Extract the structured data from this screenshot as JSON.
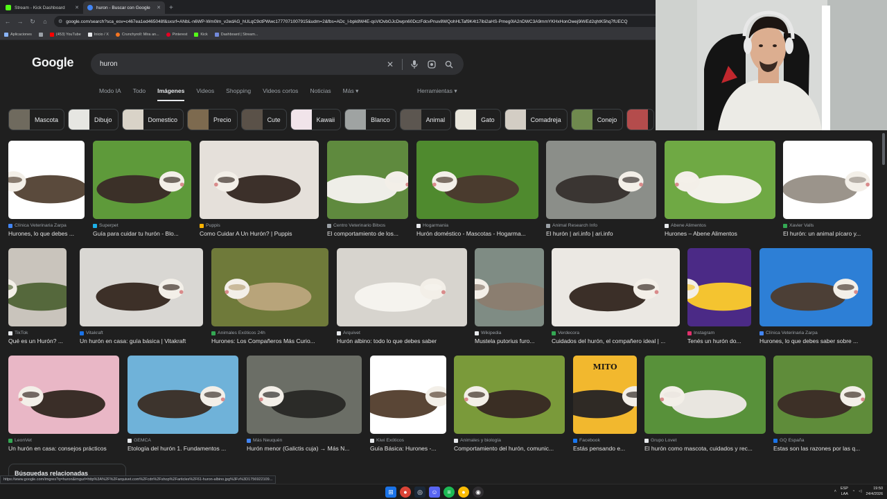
{
  "browser": {
    "tabs": [
      {
        "title": "Stream - Kick Dashboard",
        "favicon_color": "#53fc18"
      },
      {
        "title": "huron - Buscar con Google",
        "favicon_color": "#4285f4"
      }
    ],
    "new_tab_label": "+",
    "url": "google.com/search?sca_esv=c467ea1ed465048f&sxsrf=ANbL-n6WP-Wm0lm_v2edAG_hULqC9ctPWwc1777071007915&udm=2&fbs=ADc_l-bpk8W4E-qsVlOvbGJcDwpn60DczFdcvPnuv8WQohHLTaf9K4t17ibi2aHS-Pmeg0lA2nDWC3A9mmYKHxHonOwej9iWEd2qhtK5hq7fUECQ",
    "bookmarks": [
      {
        "label": "Aplicaciones",
        "color": "#8ab4f8"
      },
      {
        "label": "",
        "color": "#9aa0a6"
      },
      {
        "label": "(453) YouTube",
        "color": "#ff0000"
      },
      {
        "label": "Inicio / X",
        "color": "#e8eaed"
      },
      {
        "label": "Crunchyroll: Mira an...",
        "color": "#f47521"
      },
      {
        "label": "Pinterest",
        "color": "#e60023"
      },
      {
        "label": "Kick",
        "color": "#53fc18"
      },
      {
        "label": "Dashboard | Stream...",
        "color": "#7289da"
      }
    ]
  },
  "google": {
    "logo": "Google",
    "query": "huron",
    "tabs": [
      "Modo IA",
      "Todo",
      "Imágenes",
      "Videos",
      "Shopping",
      "Videos cortos",
      "Noticias",
      "Más ▾"
    ],
    "active_tab": "Imágenes",
    "tools": "Herramientas ▾",
    "chips": [
      {
        "label": "Mascota",
        "thumb": "#6f6a5e"
      },
      {
        "label": "Dibujo",
        "thumb": "#e6e6e2"
      },
      {
        "label": "Domestico",
        "thumb": "#d9d3c8"
      },
      {
        "label": "Precio",
        "thumb": "#7d6a4f"
      },
      {
        "label": "Cute",
        "thumb": "#5a5148"
      },
      {
        "label": "Kawaii",
        "thumb": "#f1e4ea"
      },
      {
        "label": "Blanco",
        "thumb": "#9fa3a2"
      },
      {
        "label": "Animal",
        "thumb": "#5c5650"
      },
      {
        "label": "Gato",
        "thumb": "#e9e6dc"
      },
      {
        "label": "Comadreja",
        "thumb": "#d3cdc4"
      },
      {
        "label": "Conejo",
        "thumb": "#6f8a4e"
      },
      {
        "label": "",
        "thumb": "#b44c4c"
      }
    ],
    "results_row1": [
      {
        "source": "Clínica Veterinaria Zarpa",
        "caption": "Hurones, lo que debes ...",
        "bg": "#ffffff",
        "fur": "#5a4a3c",
        "icon": "#4285f4"
      },
      {
        "source": "Superpet",
        "caption": "Guía para cuidar tu hurón - Blo...",
        "bg": "#5e9a3a",
        "fur": "#3b3028",
        "icon": "#1db0e8"
      },
      {
        "source": "Puppis",
        "caption": "Como Cuidar A Un Hurón? | Puppis",
        "bg": "#e5e0da",
        "fur": "#3c302a",
        "icon": "#ffb300"
      },
      {
        "source": "Centro Veterinario Bitxos",
        "caption": "El comportamiento de los...",
        "bg": "#5f8a3e",
        "fur": "#efeee8",
        "icon": "#9aa0a6"
      },
      {
        "source": "Hogarmania",
        "caption": "Hurón doméstico - Mascotas - Hogarma...",
        "bg": "#4f8a2e",
        "fur": "#4a3b2e",
        "icon": "#e8eaed"
      },
      {
        "source": "Animal Research Info",
        "caption": "El hurón | ari.info | ari.info",
        "bg": "#8b8e89",
        "fur": "#3a3532",
        "icon": "#9aa0a6"
      },
      {
        "source": "Abene Alimentos",
        "caption": "Hurones – Abene Alimentos",
        "bg": "#6fa944",
        "fur": "#f3f1ea",
        "icon": "#e8eaed"
      },
      {
        "source": "Xavier Valls",
        "caption": "El hurón: un animal pícaro y...",
        "bg": "#ffffff",
        "fur": "#9b948b",
        "icon": "#34a853"
      }
    ],
    "results_row2": [
      {
        "source": "TikTok",
        "caption": "Qué es un Hurón? ...",
        "bg": "#c9c4bc",
        "fur": "#55683c",
        "icon": "#e8eaed"
      },
      {
        "source": "Vitakraft",
        "caption": "Un hurón en casa: guía básica | Vitakraft",
        "bg": "#d9d7d3",
        "fur": "#3d3028",
        "icon": "#1a73e8"
      },
      {
        "source": "Animales Exóticos 24h",
        "caption": "Hurones: Los Compañeros Más Curio...",
        "bg": "#6f7a3a",
        "fur": "#b8a47a",
        "icon": "#34a853"
      },
      {
        "source": "Arquivet",
        "caption": "Hurón albino: todo lo que debes saber",
        "bg": "#d7d4ce",
        "fur": "#f5f3ee",
        "icon": "#e8eaed"
      },
      {
        "source": "Wikipedia",
        "caption": "Mustela putorius furo...",
        "bg": "#7f8c84",
        "fur": "#8b7e70",
        "icon": "#e8eaed"
      },
      {
        "source": "Verdecora",
        "caption": "Cuidados del hurón, el compañero ideal | ...",
        "bg": "#ebe8e3",
        "fur": "#3b2f28",
        "icon": "#34a853"
      },
      {
        "source": "Instagram",
        "caption": "Tenés un hurón do...",
        "bg": "#4b2a86",
        "fur": "#f4c430",
        "icon": "#e1306c"
      },
      {
        "source": "Clínica Veterinaria Zarpa",
        "caption": "Hurones, lo que debes saber sobre ...",
        "bg": "#2d7fd6",
        "fur": "#4c3f36",
        "icon": "#4285f4"
      }
    ],
    "results_row3": [
      {
        "source": "LeonVet",
        "caption": "Un hurón en casa: consejos prácticos",
        "bg": "#e9b7c6",
        "fur": "#3a2e28",
        "icon": "#34a853"
      },
      {
        "source": "GEMCA",
        "caption": "Etología del hurón 1. Fundamentos ...",
        "bg": "#6fb2d9",
        "fur": "#3d342d",
        "icon": "#e8eaed"
      },
      {
        "source": "Más Neuquén",
        "caption": "Hurón menor (Galictis cuja) → Más N...",
        "bg": "#6b6e66",
        "fur": "#2b2b28",
        "icon": "#4285f4"
      },
      {
        "source": "Kiwi Exóticos",
        "caption": "Guía Básica: Hurones -...",
        "bg": "#ffffff",
        "fur": "#5a4636",
        "icon": "#e8eaed"
      },
      {
        "source": "Animales y biología",
        "caption": "Comportamiento del hurón, comunic...",
        "bg": "#7a9a3a",
        "fur": "#3a2e24",
        "icon": "#e8eaed"
      },
      {
        "source": "Facebook",
        "caption": "Estás pensando e...",
        "bg": "#f2b82e",
        "fur": "#2f2a25",
        "icon": "#1877f2"
      },
      {
        "source": "Grupo Lovet",
        "caption": "El hurón como mascota, cuidados y rec...",
        "bg": "#58913a",
        "fur": "#e9e6e0",
        "icon": "#e8eaed"
      },
      {
        "source": "GQ España",
        "caption": "Estas son las razones por las q...",
        "bg": "#5f8c3a",
        "fur": "#3d3027",
        "icon": "#1a73e8"
      }
    ],
    "mito_text": "MITO",
    "related_title": "Búsquedas relacionadas"
  },
  "status_url": "https://www.google.com/imgres?q=huron&imgurl=http%3A%2F%2Farquivet.com%2Fcdn%2Fshop%2Farticles%2F61-huron-albino.jpg%3Fv%3D1756922109...",
  "taskbar": {
    "lang": "ESP",
    "lang2": "LAA",
    "time": "19:50",
    "date": "24/4/2026"
  }
}
